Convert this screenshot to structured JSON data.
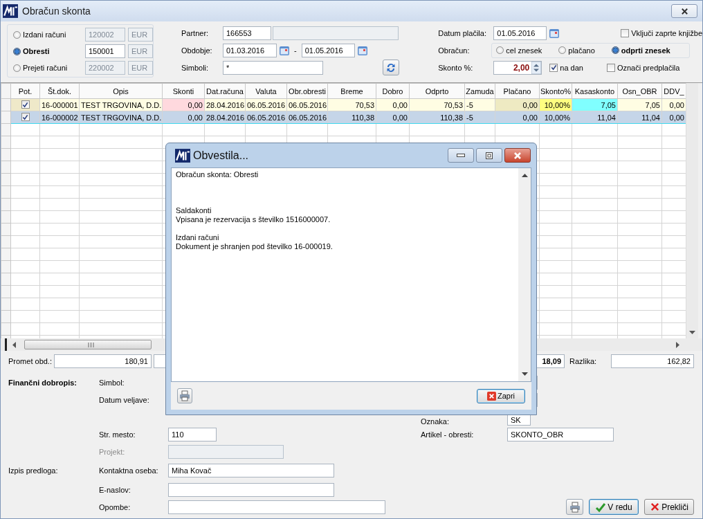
{
  "window": {
    "title": "Obračun skonta"
  },
  "source": {
    "options": [
      {
        "label": "Izdani računi",
        "selected": false,
        "account": "120002",
        "currency": "EUR"
      },
      {
        "label": "Obresti",
        "selected": true,
        "account": "150001",
        "currency": "EUR"
      },
      {
        "label": "Prejeti računi",
        "selected": false,
        "account": "220002",
        "currency": "EUR"
      }
    ]
  },
  "partner": {
    "label": "Partner:",
    "value": "166553"
  },
  "period": {
    "label": "Obdobje:",
    "from": "01.03.2016",
    "separator": "-",
    "to": "01.05.2016"
  },
  "symbols": {
    "label": "Simboli:",
    "value": "*"
  },
  "payment_date": {
    "label": "Datum plačila:",
    "value": "01.05.2016"
  },
  "calculation": {
    "label": "Obračun:",
    "options": [
      {
        "label": "cel znesek",
        "selected": false
      },
      {
        "label": "plačano",
        "selected": false
      },
      {
        "label": "odprti znesek",
        "selected": true
      }
    ]
  },
  "discount": {
    "label": "Skonto %:",
    "value": "2,00",
    "per_day": {
      "label": "na dan",
      "checked": true
    }
  },
  "options": [
    {
      "label": "Vključi zaprte knjižbe",
      "checked": false
    },
    {
      "label": "Označi predplačila",
      "checked": false
    }
  ],
  "table": {
    "columns": [
      {
        "label": "Pot.",
        "kind": "check"
      },
      {
        "label": "Št.dok.",
        "kind": "code"
      },
      {
        "label": "Opis",
        "kind": "text"
      },
      {
        "label": "Skonti",
        "kind": "number",
        "color": "#ffd9de"
      },
      {
        "label": "Dat.računa",
        "kind": "number"
      },
      {
        "label": "Valuta",
        "kind": "number"
      },
      {
        "label": "Obr.obresti",
        "kind": "number"
      },
      {
        "label": "Breme",
        "kind": "number"
      },
      {
        "label": "Dobro",
        "kind": "number"
      },
      {
        "label": "Odprto",
        "kind": "number"
      },
      {
        "label": "Zamuda",
        "kind": "text"
      },
      {
        "label": "Plačano",
        "kind": "number",
        "color": "#eeeac2"
      },
      {
        "label": "Skonto%",
        "kind": "number",
        "color": "#ffff80"
      },
      {
        "label": "Kasaskonto",
        "kind": "number",
        "color": "#80ffff"
      },
      {
        "label": "Osn_OBR",
        "kind": "number"
      },
      {
        "label": "DDV_",
        "kind": "number"
      }
    ],
    "rows": [
      {
        "checked": true,
        "selected": false,
        "cells": [
          "",
          "16-000001",
          "TEST TRGOVINA, D.D.",
          "0,00",
          "28.04.2016",
          "06.05.2016",
          "06.05.2016",
          "70,53",
          "0,00",
          "70,53",
          "-5",
          "0,00",
          "10,00%",
          "7,05",
          "7,05",
          "0,00"
        ]
      },
      {
        "checked": true,
        "selected": true,
        "cells": [
          "",
          "16-000002",
          "TEST TRGOVINA, D.D.",
          "0,00",
          "28.04.2016",
          "06.05.2016",
          "06.05.2016",
          "110,38",
          "0,00",
          "110,38",
          "-5",
          "0,00",
          "10,00%",
          "11,04",
          "11,04",
          "0,00"
        ]
      }
    ]
  },
  "totals": {
    "label": "Promet obd.:",
    "value": "180,91",
    "partial_value": "18,09",
    "difference_label": "Razlika:",
    "difference": "162,82"
  },
  "credit_note": {
    "label": "Finančni dobropis:",
    "symbol_label": "Simbol:",
    "valid_date_label": "Datum veljave:",
    "mark": {
      "label": "Oznaka:",
      "value": "SK"
    },
    "cost_center": {
      "label": "Str. mesto:",
      "value": "110"
    },
    "article": {
      "label": "Artikel - obresti:",
      "value": "SKONTO_OBR"
    },
    "project": {
      "label": "Projekt:",
      "disabled": true
    }
  },
  "print_template": {
    "label": "Izpis predloga:",
    "contact": {
      "label": "Kontaktna oseba:",
      "value": "Miha Kovač"
    },
    "email": {
      "label": "E-naslov:"
    },
    "notes": {
      "label": "Opombe:"
    }
  },
  "buttons": {
    "ok": "V redu",
    "cancel": "Prekliči"
  },
  "dialog": {
    "title": "Obvestila...",
    "blocks": [
      {
        "lines": [
          "Obračun skonta: Obresti"
        ]
      },
      {
        "lines": [
          "Saldakonti",
          "Vpisana je rezervacija s številko 1516000007."
        ]
      },
      {
        "lines": [
          "Izdani računi",
          "Dokument je shranjen pod številko 16-000019."
        ]
      }
    ],
    "close": "Zapri"
  }
}
